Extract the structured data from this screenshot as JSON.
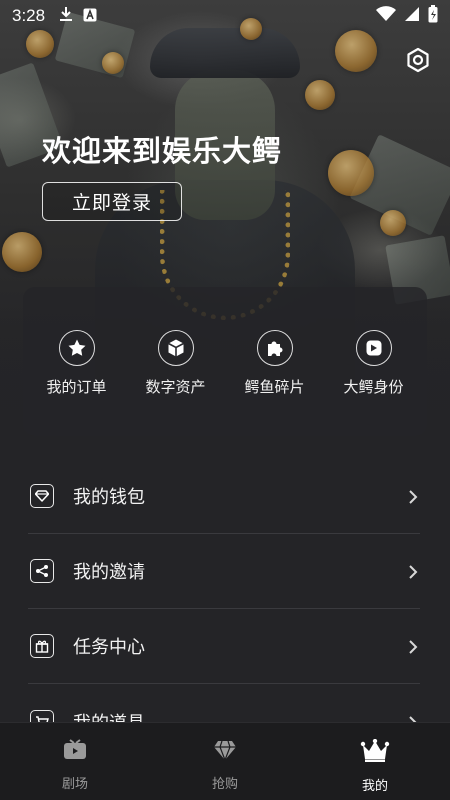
{
  "status_bar": {
    "time": "3:28",
    "icons": [
      "download-icon",
      "translate-icon",
      "wifi-icon",
      "signal-icon",
      "battery-icon"
    ]
  },
  "header": {
    "welcome": "欢迎来到娱乐大鳄",
    "login_label": "立即登录",
    "settings_icon": "settings-icon"
  },
  "quick_actions": [
    {
      "label": "我的订单",
      "icon": "star-icon"
    },
    {
      "label": "数字资产",
      "icon": "cube-icon"
    },
    {
      "label": "鳄鱼碎片",
      "icon": "puzzle-icon"
    },
    {
      "label": "大鳄身份",
      "icon": "badge-icon"
    }
  ],
  "menu": [
    {
      "label": "我的钱包",
      "icon": "diamond-icon"
    },
    {
      "label": "我的邀请",
      "icon": "share-icon"
    },
    {
      "label": "任务中心",
      "icon": "gift-icon"
    },
    {
      "label": "我的道具",
      "icon": "cart-icon"
    }
  ],
  "bottom_nav": [
    {
      "label": "剧场",
      "icon": "tv-icon",
      "active": false
    },
    {
      "label": "抢购",
      "icon": "diamond-icon",
      "active": false
    },
    {
      "label": "我的",
      "icon": "crown-icon",
      "active": true
    }
  ]
}
